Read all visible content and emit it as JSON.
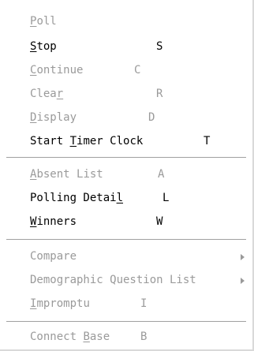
{
  "menu": {
    "items": [
      {
        "pre": "",
        "mn": "P",
        "post": "oll",
        "accel": ""
      },
      {
        "pre": "",
        "mn": "S",
        "post": "top",
        "accel": "S"
      },
      {
        "pre": "",
        "mn": "C",
        "post": "ontinue",
        "accel": "C"
      },
      {
        "pre": "Clea",
        "mn": "r",
        "post": "",
        "accel": "R"
      },
      {
        "pre": "",
        "mn": "D",
        "post": "isplay",
        "accel": "D"
      },
      {
        "pre": "Start ",
        "mn": "T",
        "post": "imer Clock",
        "accel": "T"
      },
      {
        "pre": "",
        "mn": "A",
        "post": "bsent List",
        "accel": "A"
      },
      {
        "pre": "Polling Detai",
        "mn": "l",
        "post": "",
        "accel": "L"
      },
      {
        "pre": "",
        "mn": "W",
        "post": "inners",
        "accel": "W"
      },
      {
        "text": "Compare"
      },
      {
        "text": "Demographic Question List"
      },
      {
        "pre": "",
        "mn": "I",
        "post": "mpromptu",
        "accel": "I"
      },
      {
        "pre": "Connect ",
        "mn": "B",
        "post": "ase",
        "accel": "B"
      }
    ]
  }
}
